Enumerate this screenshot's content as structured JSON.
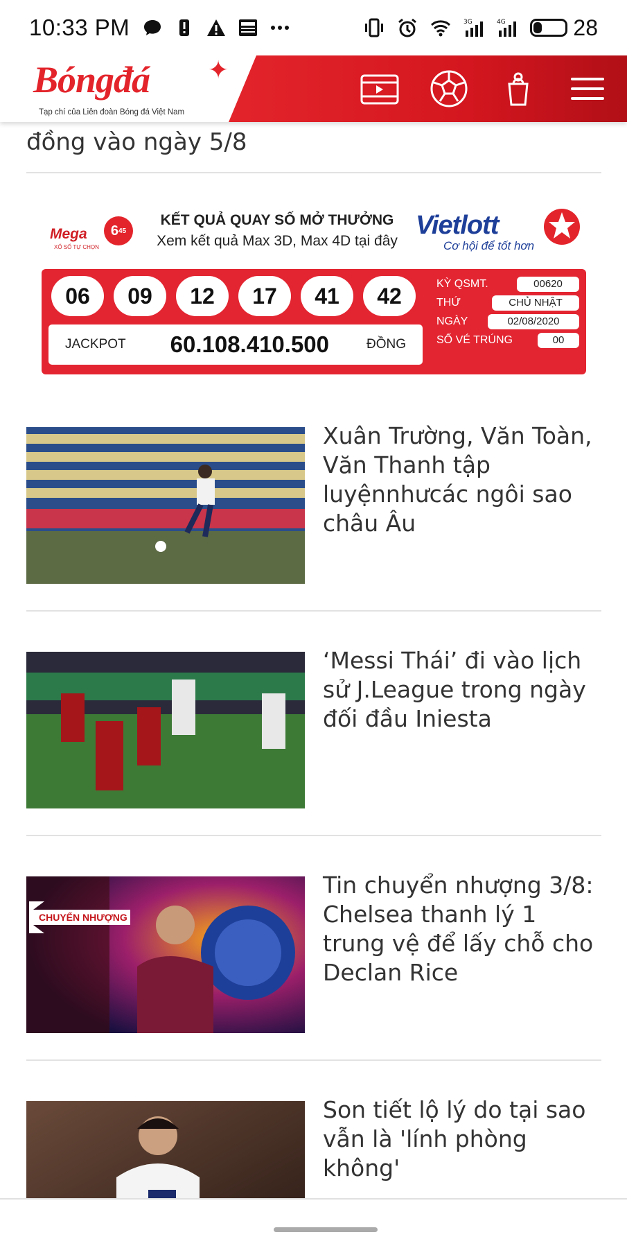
{
  "status_bar": {
    "time": "10:33 PM",
    "battery_level": "28",
    "battery_fraction": 0.28,
    "icons": [
      "chat-icon",
      "alert-icon",
      "warning-icon",
      "news-icon",
      "more-icon",
      "vibrate-icon",
      "alarm-icon",
      "wifi-icon",
      "signal-3g-icon",
      "signal-4g-icon",
      "battery-icon"
    ],
    "sig1": "3G",
    "sig2": "4G"
  },
  "header": {
    "logo_text": "Bóngđá",
    "logo_tagline": "Tạp chí của Liên đoàn Bóng đá Việt Nam",
    "brand_color": "#e3242b",
    "icons": [
      "video-icon",
      "football-icon",
      "shop-icon",
      "menu-icon"
    ]
  },
  "previous_article": {
    "title_tail": "đồng vào ngày 5/8"
  },
  "lottery": {
    "mega_logo": "Mega",
    "mega_ball": "6",
    "mega_ball_sub": "45",
    "mega_sub": "XỔ SỐ TỰ CHỌN",
    "headline": "KẾT QUẢ QUAY SỐ MỞ THƯỞNG",
    "subline": "Xem kết quả Max 3D, Max 4D tại đây",
    "vietlott": "Vietlott",
    "vietlott_slogan": "Cơ hội để tốt hơn",
    "numbers": [
      "06",
      "09",
      "12",
      "17",
      "41",
      "42"
    ],
    "jackpot_label": "JACKPOT",
    "jackpot_value": "60.108.410.500",
    "jackpot_unit": "ĐỒNG",
    "info": [
      {
        "label": "KỲ QSMT.",
        "value": "00620"
      },
      {
        "label": "THỨ",
        "value": "CHỦ NHẬT"
      },
      {
        "label": "NGÀY",
        "value": "02/08/2020"
      },
      {
        "label": "SỐ VÉ TRÚNG",
        "value": "00"
      }
    ]
  },
  "articles": [
    {
      "title": "Xuân Trường, Văn Toàn, Văn Thanh tập luyệnnhưcác ngôi sao châu Âu"
    },
    {
      "title": "‘Messi Thái’ đi vào lịch sử J.League trong ngày đối đầu Iniesta"
    },
    {
      "title": "Tin chuyển nhượng 3/8: Chelsea thanh lý 1 trung vệ để lấy chỗ cho Declan Rice",
      "thumb_badge": "CHUYỂN NHƯỢNG"
    },
    {
      "title": "Son tiết lộ lý do tại sao vẫn là 'lính phòng không'"
    }
  ]
}
